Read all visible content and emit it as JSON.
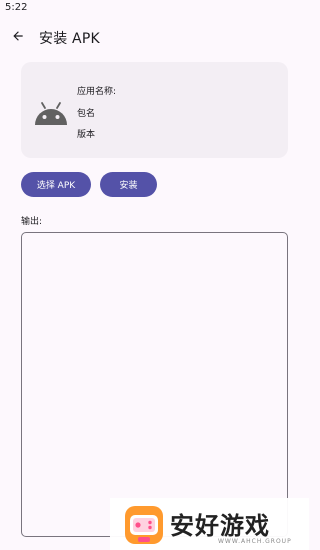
{
  "status_bar": {
    "time": "5:22"
  },
  "app_bar": {
    "title": "安装 APK",
    "back_icon": "arrow-back-icon"
  },
  "app_info": {
    "icon": "android-icon",
    "app_name_label": "应用名称:",
    "package_label": "包名",
    "version_label": "版本"
  },
  "actions": {
    "select_apk_label": "选择 APK",
    "install_label": "安装"
  },
  "output": {
    "label": "输出:",
    "value": ""
  },
  "watermark": {
    "title": "安好游戏",
    "subtitle": "WWW.AHCH.GROUP"
  },
  "colors": {
    "accent": "#5452a8",
    "card_bg": "#f3eef4",
    "page_bg": "#fdf8fd",
    "outline": "#79747e"
  }
}
